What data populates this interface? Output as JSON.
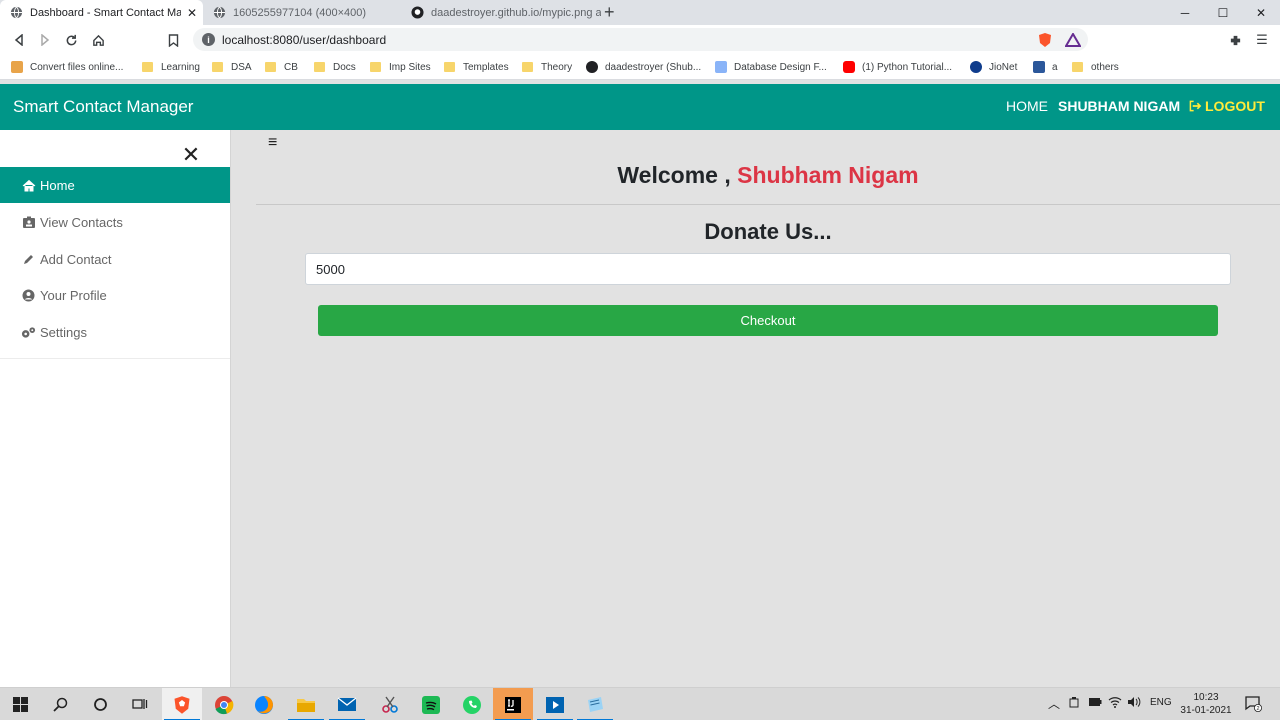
{
  "browser": {
    "tabs": [
      {
        "title": "Dashboard - Smart Contact Mana",
        "active": true
      },
      {
        "title": "1605255977104 (400×400)",
        "active": false
      },
      {
        "title": "daadestroyer.github.io/mypic.png at m",
        "active": false
      }
    ],
    "url": "localhost:8080/user/dashboard",
    "bookmarks": [
      "Convert files online...",
      "Learning",
      "DSA",
      "CB",
      "Docs",
      "Imp Sites",
      "Templates",
      "Theory",
      "daadestroyer (Shub...",
      "Database Design F...",
      "(1) Python Tutorial...",
      "JioNet",
      "a",
      "others"
    ]
  },
  "app": {
    "brand": "Smart Contact Manager",
    "nav": {
      "home": "HOME",
      "user": "SHUBHAM NIGAM",
      "logout": "LOGOUT"
    },
    "sidebar": {
      "close_glyph": "✕",
      "items": [
        {
          "label": "Home",
          "icon": "home-icon",
          "active": true
        },
        {
          "label": "View Contacts",
          "icon": "id-card-icon"
        },
        {
          "label": "Add Contact",
          "icon": "pencil-icon"
        },
        {
          "label": "Your Profile",
          "icon": "user-circle-icon"
        },
        {
          "label": "Settings",
          "icon": "gears-icon"
        }
      ]
    },
    "menu_glyph": "≡",
    "welcome_prefix": "Welcome ,",
    "welcome_name": "Shubham Nigam",
    "donate_title": "Donate Us...",
    "amount_value": "5000",
    "checkout_label": "Checkout",
    "colors": {
      "primary": "#009688",
      "danger": "#dc3545",
      "success": "#28a745",
      "logout": "#ffeb3b"
    }
  },
  "taskbar": {
    "language": "ENG",
    "time": "10:23",
    "date": "31-01-2021",
    "notifications": "2"
  }
}
